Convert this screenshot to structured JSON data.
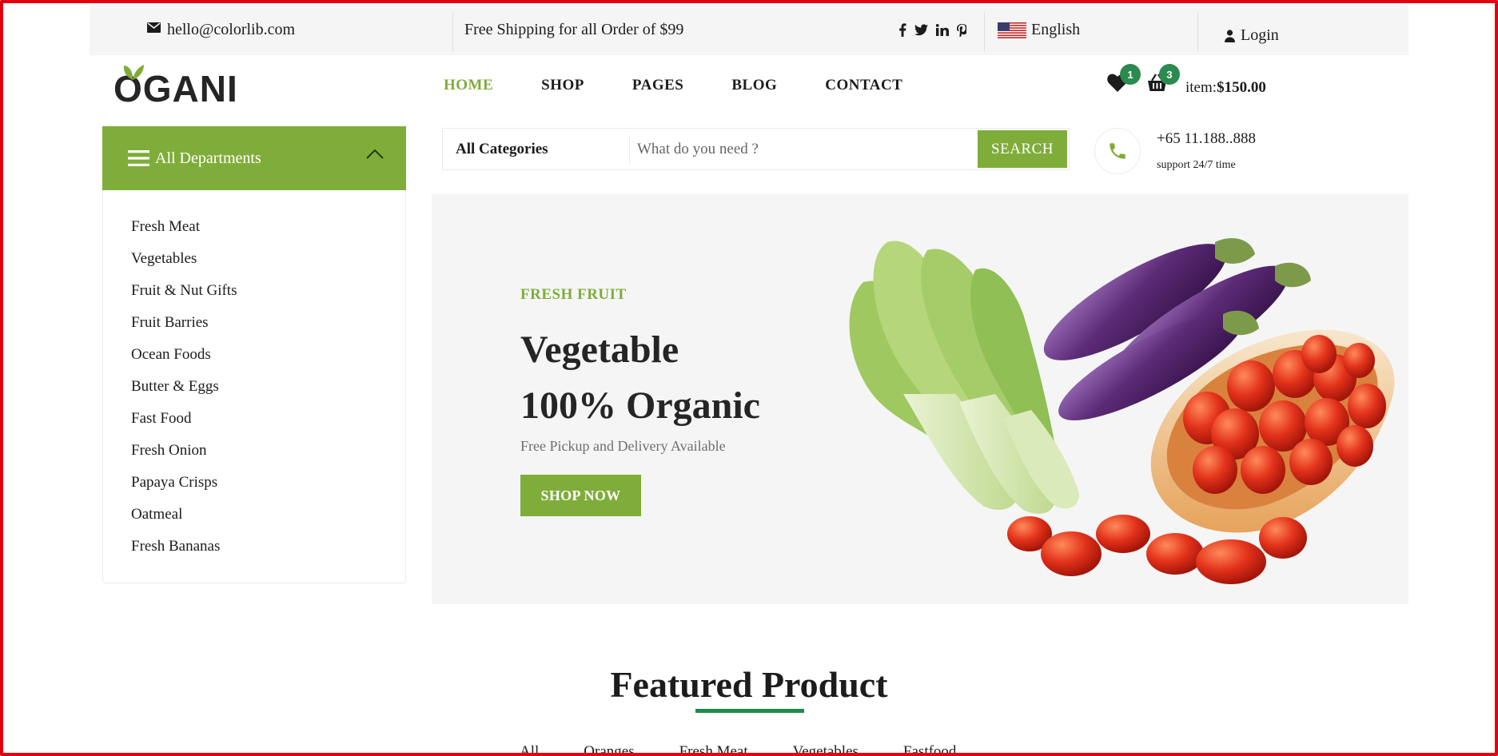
{
  "topbar": {
    "email": "hello@colorlib.com",
    "shipping": "Free Shipping for all Order of $99",
    "social": [
      "facebook-icon",
      "twitter-icon",
      "linkedin-icon",
      "pinterest-icon"
    ],
    "language": "English",
    "login": "Login"
  },
  "header": {
    "logo": "OGANI",
    "nav": [
      {
        "label": "HOME",
        "active": true
      },
      {
        "label": "SHOP"
      },
      {
        "label": "PAGES"
      },
      {
        "label": "BLOG"
      },
      {
        "label": "CONTACT"
      }
    ],
    "wishlist_count": "1",
    "cart_count": "3",
    "cart_label": "item:",
    "cart_total": "$150.00"
  },
  "departments": {
    "title": "All Departments",
    "items": [
      "Fresh Meat",
      "Vegetables",
      "Fruit & Nut Gifts",
      "Fruit Barries",
      "Ocean Foods",
      "Butter & Eggs",
      "Fast Food",
      "Fresh Onion",
      "Papaya Crisps",
      "Oatmeal",
      "Fresh Bananas"
    ]
  },
  "search": {
    "category": "All Categories",
    "placeholder": "What do you need ?",
    "button": "SEARCH"
  },
  "phone": {
    "number": "+65 11.188..888",
    "sub": "support 24/7 time"
  },
  "hero": {
    "kicker": "FRESH FRUIT",
    "title_line1": "Vegetable",
    "title_line2": "100% Organic",
    "subtitle": "Free Pickup and Delivery Available",
    "button": "SHOP NOW"
  },
  "featured": {
    "title": "Featured Product",
    "tabs": [
      "All",
      "Oranges",
      "Fresh Meat",
      "Vegetables",
      "Fastfood"
    ]
  },
  "colors": {
    "accent": "#7fad39",
    "badge": "#2a8a4f",
    "frame": "#e3000f"
  }
}
